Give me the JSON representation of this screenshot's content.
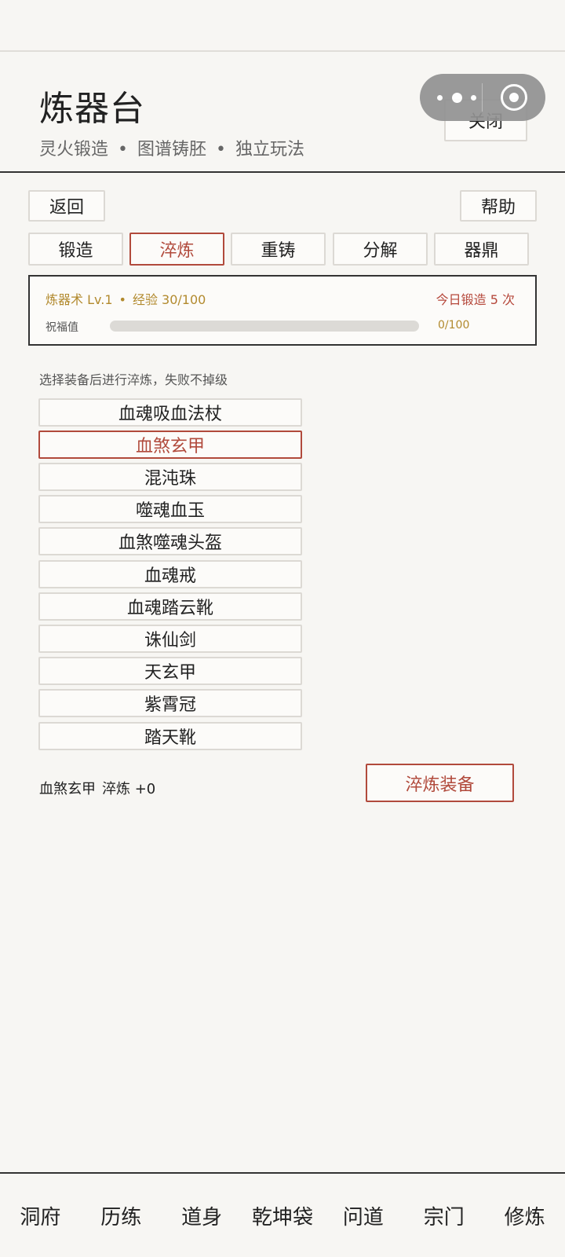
{
  "header": {
    "title": "炼器台",
    "subtitle_parts": [
      "灵火锻造",
      "图谱铸胚",
      "独立玩法"
    ],
    "subtitle_sep": "•",
    "close_label": "关闭"
  },
  "capsule": {
    "icons": [
      "more-icon",
      "target-icon"
    ]
  },
  "toolbar": {
    "back_label": "返回",
    "help_label": "帮助"
  },
  "tabs": [
    {
      "label": "锻造",
      "active": false
    },
    {
      "label": "淬炼",
      "active": true
    },
    {
      "label": "重铸",
      "active": false
    },
    {
      "label": "分解",
      "active": false
    },
    {
      "label": "器鼎",
      "active": false
    }
  ],
  "skill": {
    "name": "炼器术 Lv.1",
    "sep": "•",
    "exp": "经验 30/100",
    "daily": "今日锻造 5 次",
    "bless_label": "祝福值",
    "bless_fraction": 0,
    "bless_value": "0/100"
  },
  "hint": "选择装备后进行淬炼，失败不掉级",
  "items": [
    {
      "name": "血魂吸血法杖",
      "selected": false
    },
    {
      "name": "血煞玄甲",
      "selected": true
    },
    {
      "name": "混沌珠",
      "selected": false
    },
    {
      "name": "噬魂血玉",
      "selected": false
    },
    {
      "name": "血煞噬魂头盔",
      "selected": false
    },
    {
      "name": "血魂戒",
      "selected": false
    },
    {
      "name": "血魂踏云靴",
      "selected": false
    },
    {
      "name": "诛仙剑",
      "selected": false
    },
    {
      "name": "天玄甲",
      "selected": false
    },
    {
      "name": "紫霄冠",
      "selected": false
    },
    {
      "name": "踏天靴",
      "selected": false
    }
  ],
  "selection": {
    "item": "血煞玄甲",
    "level": "淬炼 +0"
  },
  "action_label": "淬炼装备",
  "nav": [
    "洞府",
    "历练",
    "道身",
    "乾坤袋",
    "问道",
    "宗门",
    "修炼"
  ],
  "colors": {
    "accent": "#b14a3c",
    "gold": "#b28a2e",
    "background": "#f7f6f3"
  }
}
